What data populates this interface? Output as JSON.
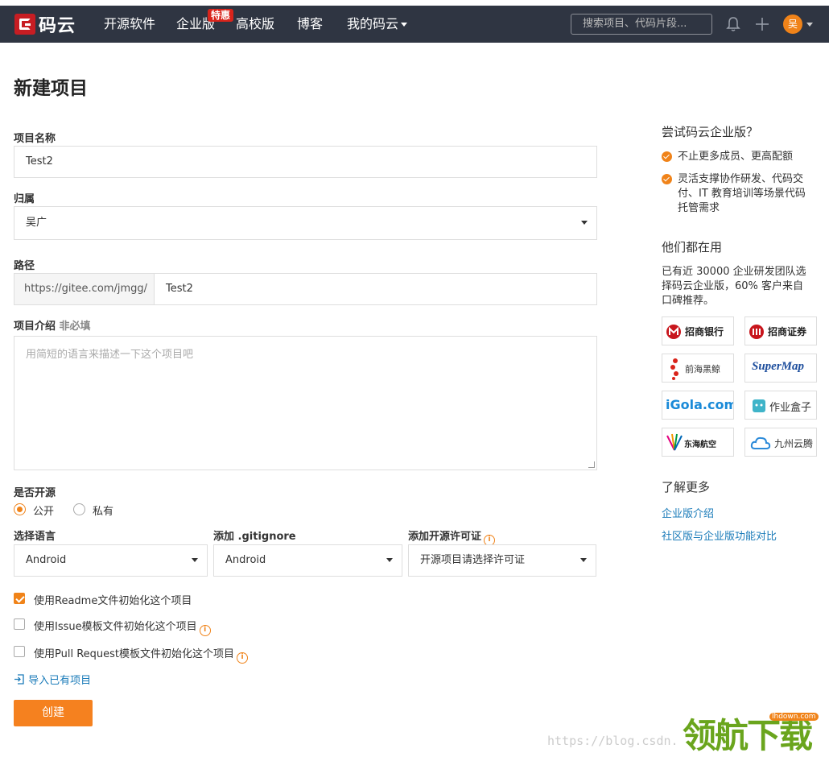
{
  "nav": {
    "logo_text": "码云",
    "items": [
      "开源软件",
      "企业版",
      "高校版",
      "博客",
      "我的码云"
    ],
    "hot_badge": "特惠",
    "search_placeholder": "搜索项目、代码片段...",
    "avatar_text": "吴"
  },
  "page": {
    "title": "新建项目"
  },
  "form": {
    "name_label": "项目名称",
    "name_value": "Test2",
    "owner_label": "归属",
    "owner_value": "吴广",
    "path_label": "路径",
    "path_prefix": "https://gitee.com/jmgg/",
    "path_value": "Test2",
    "desc_label": "项目介绍",
    "desc_optional": "非必填",
    "desc_placeholder": "用简短的语言来描述一下这个项目吧",
    "visibility_label": "是否开源",
    "public_label": "公开",
    "private_label": "私有",
    "lang_label": "选择语言",
    "lang_value": "Android",
    "gitignore_label": "添加 .gitignore",
    "gitignore_value": "Android",
    "license_label": "添加开源许可证",
    "license_value": "开源项目请选择许可证",
    "check_readme": "使用Readme文件初始化这个项目",
    "check_issue": "使用Issue模板文件初始化这个项目",
    "check_pr": "使用Pull Request模板文件初始化这个项目",
    "import_link": "导入已有项目",
    "create_button": "创建"
  },
  "sidebar": {
    "try_title": "尝试码云企业版？",
    "point1": "不止更多成员、更高配额",
    "point2_l1": "灵活支撑协作研发、代码交",
    "point2_l2": "付、IT 教育培训等场景代码",
    "point2_l3": "托管需求",
    "using_title": "他们都在用",
    "using_l1": "已有近 30000 企业研发团队选",
    "using_l2": "择码云企业版，60% 客户来自",
    "using_l3": "口碑推荐。",
    "brands": [
      "招商银行",
      "招商证券",
      "前海黑鲸",
      "SuperMap",
      "iGola.com",
      "作业盒子",
      "东海航空",
      "九州云腾"
    ],
    "more_title": "了解更多",
    "link1": "企业版介绍",
    "link2": "社区版与企业版功能对比"
  },
  "watermark": {
    "url": "https://blog.csdn.",
    "logo": "领航下载",
    "tag": "lhdown.com"
  },
  "colors": {
    "nav_bg": "#2f3542",
    "accent": "#f08319",
    "link": "#1a7bb9"
  }
}
